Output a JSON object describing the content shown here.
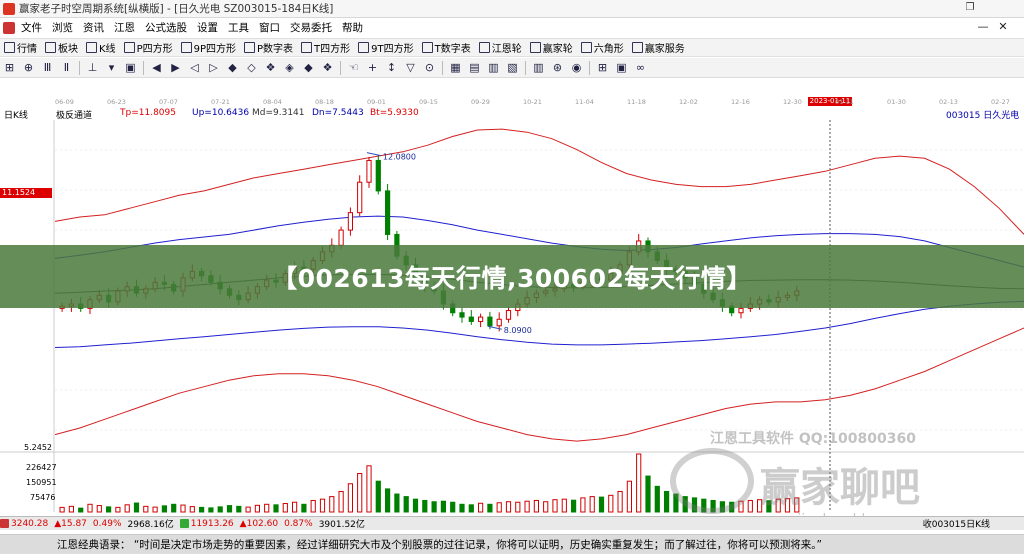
{
  "window": {
    "title": "赢家老子时空周期系统[纵横版] - [日久光电  SZ003015-184日K线]",
    "restore_glyph": "❐"
  },
  "menu": {
    "items": [
      "文件",
      "浏览",
      "资讯",
      "江恩",
      "公式选股",
      "设置",
      "工具",
      "窗口",
      "交易委托",
      "帮助"
    ],
    "close_glyph": "✕",
    "min_glyph": "—"
  },
  "toolbar1": {
    "items": [
      {
        "label": "行情",
        "icon": "quote-icon"
      },
      {
        "label": "板块",
        "icon": "sector-icon"
      },
      {
        "label": "K线",
        "icon": "kline-icon"
      },
      {
        "label": "P四方形",
        "icon": "square-icon"
      },
      {
        "label": "9P四方形",
        "icon": "square-icon"
      },
      {
        "label": "P数字表",
        "icon": "table-icon"
      },
      {
        "label": "T四方形",
        "icon": "square-icon"
      },
      {
        "label": "9T四方形",
        "icon": "square-icon"
      },
      {
        "label": "T数字表",
        "icon": "table-icon"
      },
      {
        "label": "江恩轮",
        "icon": "wheel-icon"
      },
      {
        "label": "赢家轮",
        "icon": "wheel-icon"
      },
      {
        "label": "六角形",
        "icon": "hexagon-icon"
      },
      {
        "label": "赢家服务",
        "icon": "service-icon"
      }
    ]
  },
  "toolbar2": {
    "glyphs": [
      "⊞",
      "⊕",
      "Ⅲ",
      "Ⅱ",
      "|",
      "⊥",
      "▾",
      "▣",
      "|",
      "◀",
      "▶",
      "◁",
      "▷",
      "◆",
      "◇",
      "❖",
      "◈",
      "◆",
      "❖",
      "|",
      "☜",
      "+",
      "↕",
      "▽",
      "⊙",
      "|",
      "▦",
      "▤",
      "▥",
      "▧",
      "|",
      "▥",
      "⊛",
      "◉",
      "|",
      "⊞",
      "▣",
      "∞"
    ]
  },
  "dates": {
    "ticks": [
      "06-09",
      "06-23",
      "07-07",
      "07-21",
      "08-04",
      "08-18",
      "09-01",
      "09-15",
      "09-29",
      "10-21",
      "11-04",
      "11-18",
      "12-02",
      "12-16",
      "12-30",
      "01-11",
      "01-30",
      "02-13",
      "02-27"
    ],
    "highlight": "2023-01-11"
  },
  "info": {
    "period": "日K线",
    "indicator": "极反通道",
    "tp": "Tp=11.8095",
    "up": "Up=10.6436",
    "md": "Md=9.3141",
    "dn": "Dn=7.5443",
    "bt": "Bt=5.9330",
    "stock": "003015  日久光电"
  },
  "price_tag": "11.1524",
  "chart_data": {
    "type": "candlestick",
    "annotations": [
      {
        "text": "12.0800",
        "x": "2022-08-18",
        "y": 12.08
      },
      {
        "text": "8.0900",
        "x": "2022-09-29",
        "y": 8.09
      }
    ],
    "y_min_label": "5.2452",
    "volume_ticks": [
      "226427",
      "150951",
      "75476"
    ],
    "close": [
      8.55,
      8.6,
      8.5,
      8.7,
      8.8,
      8.65,
      8.9,
      9.0,
      8.85,
      8.95,
      9.1,
      9.05,
      8.9,
      9.2,
      9.35,
      9.25,
      9.1,
      8.95,
      8.8,
      8.7,
      8.85,
      9.0,
      9.15,
      9.1,
      9.3,
      9.45,
      9.4,
      9.6,
      9.8,
      9.95,
      10.3,
      10.7,
      11.4,
      11.9,
      11.2,
      10.2,
      9.7,
      9.5,
      9.2,
      9.0,
      8.9,
      8.6,
      8.4,
      8.3,
      8.2,
      8.3,
      8.1,
      8.25,
      8.45,
      8.6,
      8.75,
      8.85,
      8.9,
      8.95,
      9.05,
      9.0,
      9.1,
      9.2,
      9.15,
      9.3,
      9.5,
      9.8,
      10.05,
      9.8,
      9.6,
      9.4,
      9.35,
      9.2,
      9.05,
      8.85,
      8.7,
      8.55,
      8.4,
      8.5,
      8.6,
      8.7,
      8.65,
      8.75,
      8.8,
      8.9
    ],
    "volume": [
      18,
      22,
      15,
      30,
      25,
      20,
      18,
      28,
      35,
      22,
      19,
      24,
      30,
      27,
      21,
      18,
      16,
      20,
      25,
      22,
      19,
      26,
      30,
      28,
      33,
      38,
      30,
      45,
      50,
      60,
      80,
      110,
      150,
      180,
      120,
      90,
      70,
      60,
      50,
      45,
      40,
      42,
      38,
      30,
      28,
      34,
      30,
      36,
      40,
      38,
      42,
      45,
      40,
      48,
      50,
      46,
      55,
      60,
      58,
      65,
      80,
      120,
      226,
      140,
      100,
      80,
      70,
      60,
      55,
      50,
      45,
      40,
      38,
      42,
      45,
      48,
      44,
      50,
      52,
      55
    ],
    "upper_outer": [
      10.5,
      10.6,
      10.65,
      10.8,
      10.95,
      11.1,
      11.2,
      11.35,
      11.5,
      11.6,
      11.7,
      11.8,
      11.9,
      12.0,
      12.1,
      12.25,
      12.45,
      12.6,
      12.62,
      12.55,
      12.4,
      12.15,
      11.85,
      11.6,
      11.45,
      11.35,
      11.3,
      11.3,
      11.35,
      11.45,
      11.55,
      11.65,
      11.8,
      11.95,
      12.0,
      11.95,
      11.7,
      11.3,
      10.8,
      10.2
    ],
    "upper_band": [
      9.65,
      9.72,
      9.8,
      9.9,
      10.0,
      10.08,
      10.14,
      10.2,
      10.3,
      10.4,
      10.48,
      10.55,
      10.6,
      10.62,
      10.6,
      10.52,
      10.42,
      10.3,
      10.2,
      10.1,
      10.0,
      9.92,
      9.86,
      9.83,
      9.85,
      9.9,
      9.98,
      10.05,
      10.12,
      10.17,
      10.2,
      10.22,
      10.22,
      10.2,
      10.15,
      10.05,
      9.9,
      9.75,
      9.6,
      9.45
    ],
    "mid_band": [
      8.85,
      8.87,
      8.9,
      8.92,
      8.95,
      9.0,
      9.05,
      9.1,
      9.15,
      9.2,
      9.24,
      9.27,
      9.28,
      9.28,
      9.26,
      9.22,
      9.17,
      9.1,
      9.05,
      9.0,
      8.98,
      8.97,
      8.98,
      9.0,
      9.03,
      9.06,
      9.09,
      9.12,
      9.14,
      9.15,
      9.16,
      9.16,
      9.15,
      9.13,
      9.1,
      9.06,
      9.02,
      8.99,
      8.96,
      8.95
    ],
    "lower_band": [
      7.6,
      7.62,
      7.66,
      7.7,
      7.75,
      7.8,
      7.85,
      7.9,
      7.95,
      8.0,
      8.04,
      8.07,
      8.08,
      8.08,
      8.05,
      8.0,
      7.93,
      7.85,
      7.78,
      7.72,
      7.68,
      7.66,
      7.66,
      7.68,
      7.7,
      7.73,
      7.76,
      7.8,
      7.85,
      7.9,
      7.97,
      8.05,
      8.15,
      8.27,
      8.38,
      8.48,
      8.55,
      8.6,
      8.64,
      8.66
    ],
    "lower_outer": [
      5.6,
      5.75,
      5.95,
      6.15,
      6.35,
      6.55,
      6.7,
      6.85,
      6.95,
      7.0,
      7.0,
      6.95,
      6.85,
      6.7,
      6.5,
      6.3,
      6.1,
      5.9,
      5.75,
      5.6,
      5.5,
      5.45,
      5.5,
      5.6,
      5.75,
      5.9,
      6.05,
      6.2,
      6.3,
      6.35,
      6.35,
      6.4,
      6.5,
      6.65,
      6.85,
      7.05,
      7.3,
      7.55,
      7.8,
      8.05
    ],
    "ylim": [
      5.2452,
      12.6
    ]
  },
  "watermark": {
    "text": "江恩工具软件  QQ:100800360",
    "big": "赢家聊吧",
    "url": "www.jiaoba.vhk"
  },
  "status": {
    "sh": "3240.28",
    "sh_change": "▲15.87",
    "sh_pct": "0.49%",
    "sh_amount": "2968.16亿",
    "sz": "11913.26",
    "sz_change": "▲102.60",
    "sz_pct": "0.87%",
    "sz_amount": "3901.52亿",
    "right": "收003015日K线"
  },
  "quote": "江恩经典语录：  “时间是决定市场走势的重要因素，经过详细研究大市及个别股票的过往记录，你将可以证明，历史确实重复发生；而了解过往，你将可以预测将来。”",
  "banner": "【002613每天行情,300602每天行情】",
  "colors": {
    "up": "#d00000",
    "down": "#008000",
    "outer_band": "#d42020",
    "inner_band": "#2020d0",
    "mid_band": "#404040",
    "banner_bg": "#4a7a3c"
  }
}
